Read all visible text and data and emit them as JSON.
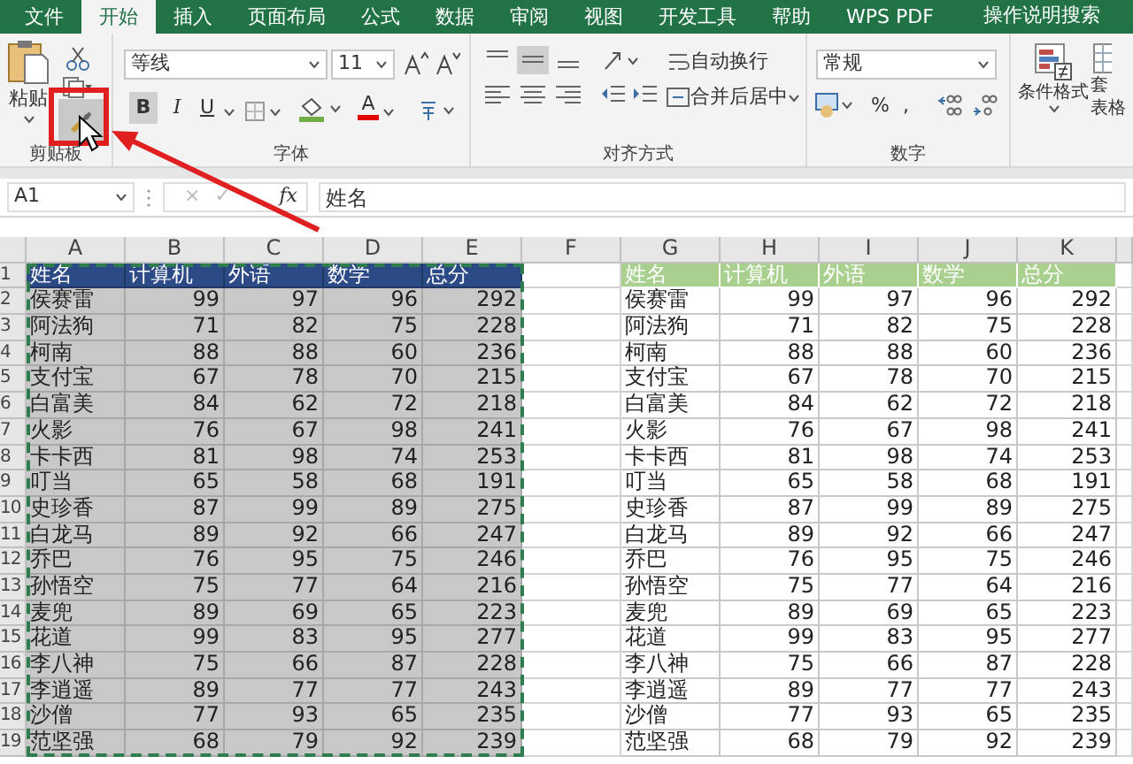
{
  "tabs": [
    {
      "label": "文件",
      "selected": false
    },
    {
      "label": "开始",
      "selected": true
    },
    {
      "label": "插入",
      "selected": false
    },
    {
      "label": "页面布局",
      "selected": false
    },
    {
      "label": "公式",
      "selected": false
    },
    {
      "label": "数据",
      "selected": false
    },
    {
      "label": "审阅",
      "selected": false
    },
    {
      "label": "视图",
      "selected": false
    },
    {
      "label": "开发工具",
      "selected": false
    },
    {
      "label": "帮助",
      "selected": false
    },
    {
      "label": "WPS PDF",
      "selected": false
    }
  ],
  "search": {
    "placeholder": "操作说明搜索"
  },
  "clipboard": {
    "paste": "粘贴",
    "group": "剪贴板",
    "format_painter_hovered": true
  },
  "font": {
    "font_name": "等线",
    "font_size": "11",
    "bold": "B",
    "italic": "I",
    "underline": "U",
    "font_color": "A",
    "group": "字体"
  },
  "alignment": {
    "wrap": "自动换行",
    "merge": "合并后居中",
    "group": "对齐方式"
  },
  "number": {
    "format": "常规",
    "percent": "%",
    "comma": ",",
    "group": "数字"
  },
  "styles": {
    "conditional": "条件格式",
    "table_top": "套",
    "table_bottom": "表格"
  },
  "formula_bar": {
    "name_box": "A1",
    "cancel": "×",
    "enter": "✓",
    "function": "fx",
    "value": "姓名"
  },
  "columns": [
    "A",
    "B",
    "C",
    "D",
    "E",
    "F",
    "G",
    "H",
    "I",
    "J",
    "K"
  ],
  "row_numbers": [
    "1",
    "2",
    "3",
    "4",
    "5",
    "6",
    "7",
    "8",
    "9",
    "10",
    "11",
    "12",
    "13",
    "14",
    "15",
    "16",
    "17",
    "18",
    "19"
  ],
  "left_table": {
    "selected": true,
    "copy_marquee": true,
    "header": [
      "姓名",
      "计算机",
      "外语",
      "数学",
      "总分"
    ],
    "rows": [
      [
        "侯赛雷",
        "99",
        "97",
        "96",
        "292"
      ],
      [
        "阿法狗",
        "71",
        "82",
        "75",
        "228"
      ],
      [
        "柯南",
        "88",
        "88",
        "60",
        "236"
      ],
      [
        "支付宝",
        "67",
        "78",
        "70",
        "215"
      ],
      [
        "白富美",
        "84",
        "62",
        "72",
        "218"
      ],
      [
        "火影",
        "76",
        "67",
        "98",
        "241"
      ],
      [
        "卡卡西",
        "81",
        "98",
        "74",
        "253"
      ],
      [
        "叮当",
        "65",
        "58",
        "68",
        "191"
      ],
      [
        "史珍香",
        "87",
        "99",
        "89",
        "275"
      ],
      [
        "白龙马",
        "89",
        "92",
        "66",
        "247"
      ],
      [
        "乔巴",
        "76",
        "95",
        "75",
        "246"
      ],
      [
        "孙悟空",
        "75",
        "77",
        "64",
        "216"
      ],
      [
        "麦兜",
        "89",
        "69",
        "65",
        "223"
      ],
      [
        "花道",
        "99",
        "83",
        "95",
        "277"
      ],
      [
        "李八神",
        "75",
        "66",
        "87",
        "228"
      ],
      [
        "李逍遥",
        "89",
        "77",
        "77",
        "243"
      ],
      [
        "沙僧",
        "77",
        "93",
        "65",
        "235"
      ],
      [
        "范坚强",
        "68",
        "79",
        "92",
        "239"
      ]
    ]
  },
  "right_table": {
    "selected": false,
    "copy_marquee": false,
    "header": [
      "姓名",
      "计算机",
      "外语",
      "数学",
      "总分"
    ],
    "rows": [
      [
        "侯赛雷",
        "99",
        "97",
        "96",
        "292"
      ],
      [
        "阿法狗",
        "71",
        "82",
        "75",
        "228"
      ],
      [
        "柯南",
        "88",
        "88",
        "60",
        "236"
      ],
      [
        "支付宝",
        "67",
        "78",
        "70",
        "215"
      ],
      [
        "白富美",
        "84",
        "62",
        "72",
        "218"
      ],
      [
        "火影",
        "76",
        "67",
        "98",
        "241"
      ],
      [
        "卡卡西",
        "81",
        "98",
        "74",
        "253"
      ],
      [
        "叮当",
        "65",
        "58",
        "68",
        "191"
      ],
      [
        "史珍香",
        "87",
        "99",
        "89",
        "275"
      ],
      [
        "白龙马",
        "89",
        "92",
        "66",
        "247"
      ],
      [
        "乔巴",
        "76",
        "95",
        "75",
        "246"
      ],
      [
        "孙悟空",
        "75",
        "77",
        "64",
        "216"
      ],
      [
        "麦兜",
        "89",
        "69",
        "65",
        "223"
      ],
      [
        "花道",
        "99",
        "83",
        "95",
        "277"
      ],
      [
        "李八神",
        "75",
        "66",
        "87",
        "228"
      ],
      [
        "李逍遥",
        "89",
        "77",
        "77",
        "243"
      ],
      [
        "沙僧",
        "77",
        "93",
        "65",
        "235"
      ],
      [
        "范坚强",
        "68",
        "79",
        "92",
        "239"
      ]
    ]
  }
}
